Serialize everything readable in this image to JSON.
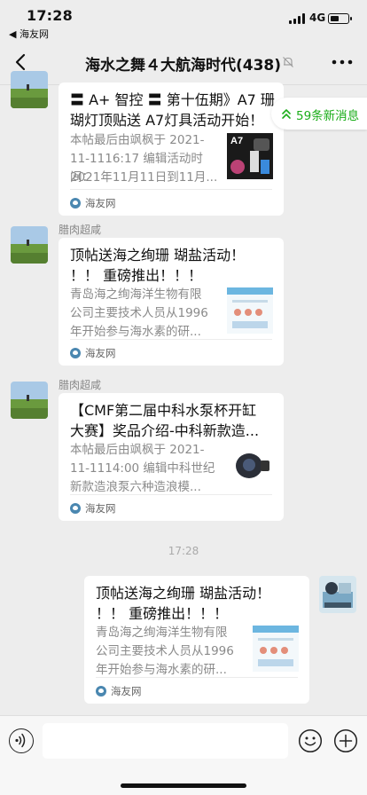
{
  "status": {
    "time": "17:28",
    "back_app": "◀ 海友网",
    "network": "4G",
    "battery_level": 0.55
  },
  "header": {
    "title": "海水之舞４大航海时代(438)"
  },
  "new_messages": {
    "label": "59条新消息"
  },
  "messages": [
    {
      "sender": "",
      "title_lines": [
        "〓 A+ 智控 〓 第十伍期》A7 珊",
        "瑚灯顶贴送 A7灯具活动开始！"
      ],
      "desc_lines": [
        "本帖最后由飒枫于 2021-",
        "11-1116:17 编辑活动时间：",
        "2021年11月11日到11月..."
      ],
      "thumb_label": "A7",
      "source": "海友网"
    },
    {
      "sender": "腊肉超咸",
      "title_lines": [
        "顶帖送海之绚珊 瑚盐活动！",
        "！！ 重磅推出！！！"
      ],
      "desc_lines": [
        "青岛海之绚海洋生物有限",
        "公司主要技术人员从1996",
        "年开始参与海水素的研..."
      ],
      "thumb_label": "",
      "source": "海友网"
    },
    {
      "sender": "腊肉超咸",
      "title_lines": [
        "【CMF第二届中科水泵杯开缸",
        "大赛】奖品介绍-中科新款造..."
      ],
      "desc_lines": [
        "本帖最后由飒枫于 2021-",
        "11-1114:00 编辑中科世纪",
        "新款造浪泵六种造浪模..."
      ],
      "thumb_label": "",
      "source": "海友网"
    },
    {
      "sender": "",
      "title_lines": [
        "顶帖送海之绚珊 瑚盐活动！",
        "！！ 重磅推出！！！"
      ],
      "desc_lines": [
        "青岛海之绚海洋生物有限",
        "公司主要技术人员从1996",
        "年开始参与海水素的研..."
      ],
      "thumb_label": "",
      "source": "海友网"
    }
  ],
  "timestamp": "17:28",
  "input": {
    "value": "",
    "placeholder": ""
  }
}
